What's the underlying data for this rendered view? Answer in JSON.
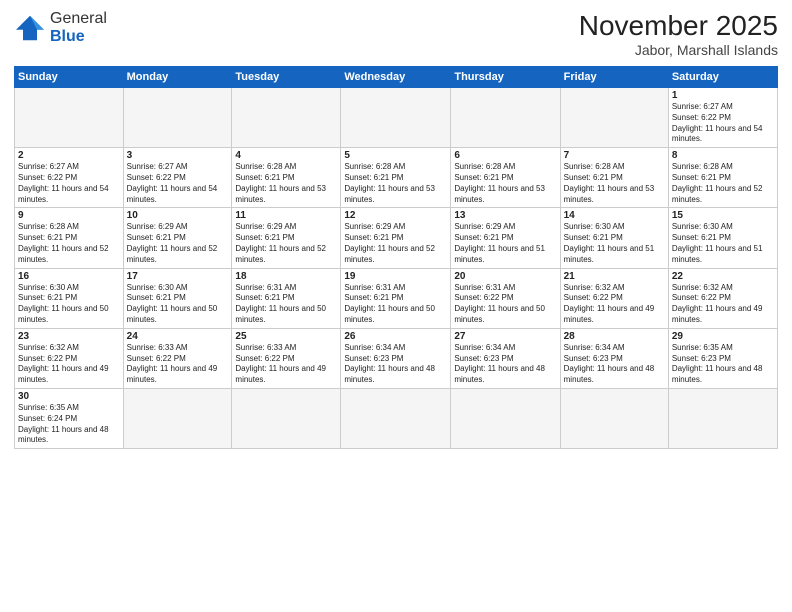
{
  "header": {
    "logo_general": "General",
    "logo_blue": "Blue",
    "month_title": "November 2025",
    "location": "Jabor, Marshall Islands"
  },
  "days_of_week": [
    "Sunday",
    "Monday",
    "Tuesday",
    "Wednesday",
    "Thursday",
    "Friday",
    "Saturday"
  ],
  "weeks": [
    [
      {
        "day": "",
        "empty": true
      },
      {
        "day": "",
        "empty": true
      },
      {
        "day": "",
        "empty": true
      },
      {
        "day": "",
        "empty": true
      },
      {
        "day": "",
        "empty": true
      },
      {
        "day": "",
        "empty": true
      },
      {
        "day": "1",
        "sunrise": "Sunrise: 6:27 AM",
        "sunset": "Sunset: 6:22 PM",
        "daylight": "Daylight: 11 hours and 54 minutes."
      }
    ],
    [
      {
        "day": "2",
        "sunrise": "Sunrise: 6:27 AM",
        "sunset": "Sunset: 6:22 PM",
        "daylight": "Daylight: 11 hours and 54 minutes."
      },
      {
        "day": "3",
        "sunrise": "Sunrise: 6:27 AM",
        "sunset": "Sunset: 6:22 PM",
        "daylight": "Daylight: 11 hours and 54 minutes."
      },
      {
        "day": "4",
        "sunrise": "Sunrise: 6:28 AM",
        "sunset": "Sunset: 6:21 PM",
        "daylight": "Daylight: 11 hours and 53 minutes."
      },
      {
        "day": "5",
        "sunrise": "Sunrise: 6:28 AM",
        "sunset": "Sunset: 6:21 PM",
        "daylight": "Daylight: 11 hours and 53 minutes."
      },
      {
        "day": "6",
        "sunrise": "Sunrise: 6:28 AM",
        "sunset": "Sunset: 6:21 PM",
        "daylight": "Daylight: 11 hours and 53 minutes."
      },
      {
        "day": "7",
        "sunrise": "Sunrise: 6:28 AM",
        "sunset": "Sunset: 6:21 PM",
        "daylight": "Daylight: 11 hours and 53 minutes."
      },
      {
        "day": "8",
        "sunrise": "Sunrise: 6:28 AM",
        "sunset": "Sunset: 6:21 PM",
        "daylight": "Daylight: 11 hours and 52 minutes."
      }
    ],
    [
      {
        "day": "9",
        "sunrise": "Sunrise: 6:28 AM",
        "sunset": "Sunset: 6:21 PM",
        "daylight": "Daylight: 11 hours and 52 minutes."
      },
      {
        "day": "10",
        "sunrise": "Sunrise: 6:29 AM",
        "sunset": "Sunset: 6:21 PM",
        "daylight": "Daylight: 11 hours and 52 minutes."
      },
      {
        "day": "11",
        "sunrise": "Sunrise: 6:29 AM",
        "sunset": "Sunset: 6:21 PM",
        "daylight": "Daylight: 11 hours and 52 minutes."
      },
      {
        "day": "12",
        "sunrise": "Sunrise: 6:29 AM",
        "sunset": "Sunset: 6:21 PM",
        "daylight": "Daylight: 11 hours and 52 minutes."
      },
      {
        "day": "13",
        "sunrise": "Sunrise: 6:29 AM",
        "sunset": "Sunset: 6:21 PM",
        "daylight": "Daylight: 11 hours and 51 minutes."
      },
      {
        "day": "14",
        "sunrise": "Sunrise: 6:30 AM",
        "sunset": "Sunset: 6:21 PM",
        "daylight": "Daylight: 11 hours and 51 minutes."
      },
      {
        "day": "15",
        "sunrise": "Sunrise: 6:30 AM",
        "sunset": "Sunset: 6:21 PM",
        "daylight": "Daylight: 11 hours and 51 minutes."
      }
    ],
    [
      {
        "day": "16",
        "sunrise": "Sunrise: 6:30 AM",
        "sunset": "Sunset: 6:21 PM",
        "daylight": "Daylight: 11 hours and 50 minutes."
      },
      {
        "day": "17",
        "sunrise": "Sunrise: 6:30 AM",
        "sunset": "Sunset: 6:21 PM",
        "daylight": "Daylight: 11 hours and 50 minutes."
      },
      {
        "day": "18",
        "sunrise": "Sunrise: 6:31 AM",
        "sunset": "Sunset: 6:21 PM",
        "daylight": "Daylight: 11 hours and 50 minutes."
      },
      {
        "day": "19",
        "sunrise": "Sunrise: 6:31 AM",
        "sunset": "Sunset: 6:21 PM",
        "daylight": "Daylight: 11 hours and 50 minutes."
      },
      {
        "day": "20",
        "sunrise": "Sunrise: 6:31 AM",
        "sunset": "Sunset: 6:22 PM",
        "daylight": "Daylight: 11 hours and 50 minutes."
      },
      {
        "day": "21",
        "sunrise": "Sunrise: 6:32 AM",
        "sunset": "Sunset: 6:22 PM",
        "daylight": "Daylight: 11 hours and 49 minutes."
      },
      {
        "day": "22",
        "sunrise": "Sunrise: 6:32 AM",
        "sunset": "Sunset: 6:22 PM",
        "daylight": "Daylight: 11 hours and 49 minutes."
      }
    ],
    [
      {
        "day": "23",
        "sunrise": "Sunrise: 6:32 AM",
        "sunset": "Sunset: 6:22 PM",
        "daylight": "Daylight: 11 hours and 49 minutes."
      },
      {
        "day": "24",
        "sunrise": "Sunrise: 6:33 AM",
        "sunset": "Sunset: 6:22 PM",
        "daylight": "Daylight: 11 hours and 49 minutes."
      },
      {
        "day": "25",
        "sunrise": "Sunrise: 6:33 AM",
        "sunset": "Sunset: 6:22 PM",
        "daylight": "Daylight: 11 hours and 49 minutes."
      },
      {
        "day": "26",
        "sunrise": "Sunrise: 6:34 AM",
        "sunset": "Sunset: 6:23 PM",
        "daylight": "Daylight: 11 hours and 48 minutes."
      },
      {
        "day": "27",
        "sunrise": "Sunrise: 6:34 AM",
        "sunset": "Sunset: 6:23 PM",
        "daylight": "Daylight: 11 hours and 48 minutes."
      },
      {
        "day": "28",
        "sunrise": "Sunrise: 6:34 AM",
        "sunset": "Sunset: 6:23 PM",
        "daylight": "Daylight: 11 hours and 48 minutes."
      },
      {
        "day": "29",
        "sunrise": "Sunrise: 6:35 AM",
        "sunset": "Sunset: 6:23 PM",
        "daylight": "Daylight: 11 hours and 48 minutes."
      }
    ],
    [
      {
        "day": "30",
        "sunrise": "Sunrise: 6:35 AM",
        "sunset": "Sunset: 6:24 PM",
        "daylight": "Daylight: 11 hours and 48 minutes."
      },
      {
        "day": "",
        "empty": true
      },
      {
        "day": "",
        "empty": true
      },
      {
        "day": "",
        "empty": true
      },
      {
        "day": "",
        "empty": true
      },
      {
        "day": "",
        "empty": true
      },
      {
        "day": "",
        "empty": true
      }
    ]
  ]
}
